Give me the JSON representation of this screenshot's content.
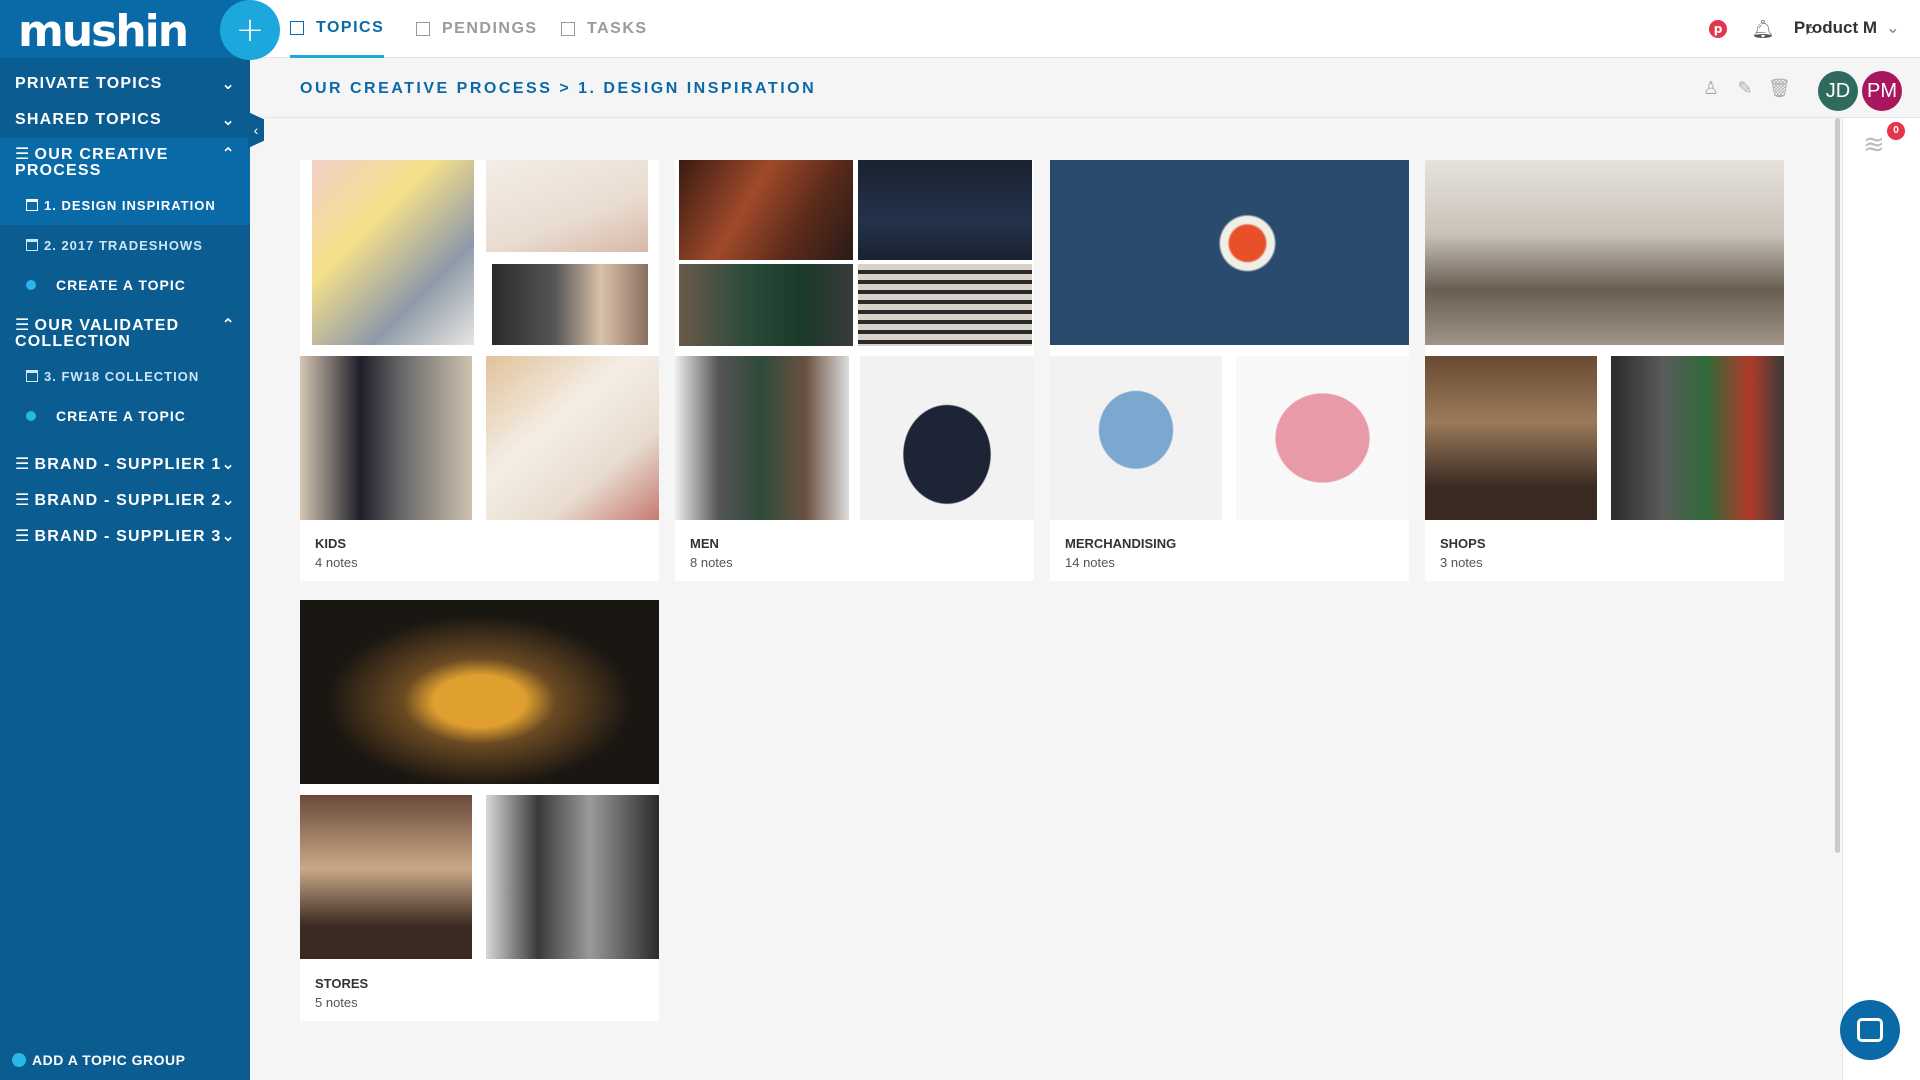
{
  "app": {
    "logo": "mushin",
    "add_label": "+"
  },
  "topnav": {
    "tabs": [
      {
        "label": "TOPICS",
        "active": true
      },
      {
        "label": "PENDINGS",
        "active": false
      },
      {
        "label": "TASKS",
        "active": false
      }
    ],
    "icons": [
      "pinterest-icon",
      "bell-icon",
      "search-icon"
    ],
    "user_name": "Product M"
  },
  "sidebar": {
    "groups": [
      {
        "label": "PRIVATE TOPICS",
        "collapsed": true
      },
      {
        "label": "SHARED TOPICS",
        "collapsed": true
      },
      {
        "label": "OUR CREATIVE PROCESS",
        "expanded": true,
        "items": [
          "1. DESIGN INSPIRATION",
          "2. 2017 TRADESHOWS"
        ],
        "create": "CREATE A TOPIC"
      },
      {
        "label": "OUR VALIDATED COLLECTION",
        "expanded": true,
        "items": [
          "3. FW18 COLLECTION"
        ],
        "create": "CREATE A TOPIC"
      },
      {
        "label": "BRAND - SUPPLIER 1",
        "collapsed": true
      },
      {
        "label": "BRAND - SUPPLIER 2",
        "collapsed": true
      },
      {
        "label": "BRAND - SUPPLIER 3",
        "collapsed": true
      }
    ],
    "add_group": "ADD A TOPIC GROUP"
  },
  "breadcrumb": "OUR CREATIVE PROCESS > 1. DESIGN INSPIRATION",
  "avatars": [
    {
      "initials": "JD",
      "color": "#2e6b5e"
    },
    {
      "initials": "PM",
      "color": "#a8175e"
    }
  ],
  "notifications": {
    "count": "0"
  },
  "cards": [
    {
      "title": "KIDS",
      "notes": "4 notes"
    },
    {
      "title": "MEN",
      "notes": "8 notes"
    },
    {
      "title": "MERCHANDISING",
      "notes": "14 notes"
    },
    {
      "title": "SHOPS",
      "notes": "3 notes"
    },
    {
      "title": "STORES",
      "notes": "5 notes"
    }
  ],
  "colors": {
    "sidebar": "#0a5c91",
    "accent": "#1da8dd",
    "link": "#0a6aa7"
  }
}
